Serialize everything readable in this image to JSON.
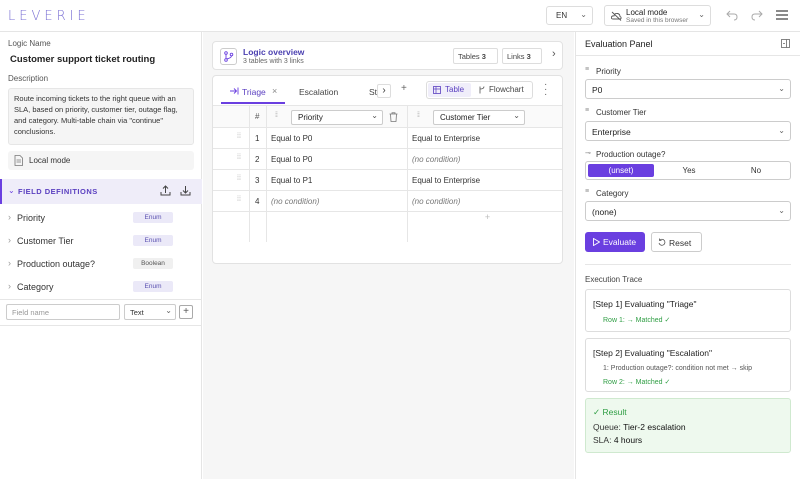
{
  "app": {
    "logo": "LEVERIE"
  },
  "topbar": {
    "language": "EN",
    "mode_title": "Local mode",
    "mode_subtitle": "Saved in this browser"
  },
  "left": {
    "logic_name_label": "Logic Name",
    "logic_name": "Customer support ticket routing",
    "description_label": "Description",
    "description": "Route incoming tickets to the right queue with an SLA, based on priority, customer tier, outage flag, and category. Multi-table chain via \"continue\" conclusions.",
    "local_mode": "Local mode",
    "field_definitions_title": "FIELD DEFINITIONS",
    "fields": [
      {
        "name": "Priority",
        "type": "Enum"
      },
      {
        "name": "Customer Tier",
        "type": "Enum"
      },
      {
        "name": "Production outage?",
        "type": "Boolean"
      },
      {
        "name": "Category",
        "type": "Enum"
      }
    ],
    "new_field_placeholder": "Field name",
    "new_field_type": "Text",
    "add_symbol": "+"
  },
  "overview": {
    "title": "Logic overview",
    "subtitle": "3 tables with 3 links",
    "tables_label": "Tables",
    "tables_count": "3",
    "links_label": "Links",
    "links_count": "3"
  },
  "tabs": [
    {
      "label": "Triage"
    },
    {
      "label": "Escalation"
    },
    {
      "label": "Sta"
    }
  ],
  "view": {
    "table": "Table",
    "flowchart": "Flowchart"
  },
  "table": {
    "hash": "#",
    "col1": "Priority",
    "col2": "Customer Tier",
    "rows": [
      {
        "n": "1",
        "c1": "Equal to P0",
        "c2": "Equal to Enterprise"
      },
      {
        "n": "2",
        "c1": "Equal to P0",
        "c2": "(no condition)"
      },
      {
        "n": "3",
        "c1": "Equal to P1",
        "c2": "Equal to Enterprise"
      },
      {
        "n": "4",
        "c1": "(no condition)",
        "c2": "(no condition)"
      }
    ],
    "add_row": "+"
  },
  "eval": {
    "title": "Evaluation Panel",
    "priority_label": "Priority",
    "priority_value": "P0",
    "tier_label": "Customer Tier",
    "tier_value": "Enterprise",
    "outage_label": "Production outage?",
    "outage_options": [
      "(unset)",
      "Yes",
      "No"
    ],
    "category_label": "Category",
    "category_value": "(none)",
    "evaluate": "Evaluate",
    "reset": "Reset",
    "trace_title": "Execution Trace",
    "step1_title": "[Step 1] Evaluating \"Triage\"",
    "step1_line": "Row 1: → Matched ✓",
    "step2_title": "[Step 2] Evaluating \"Escalation\"",
    "step2_line1": "1: Production outage?: condition not met → skip",
    "step2_line2": "Row 2: → Matched ✓",
    "result_title": "✓ Result",
    "queue_label": "Queue:",
    "queue_value": "Tier-2 escalation",
    "sla_label": "SLA:",
    "sla_value": "4 hours"
  },
  "colors": {
    "accent": "#6a3fe0",
    "success": "#2f9e44",
    "result_bg": "#eef9ee"
  }
}
